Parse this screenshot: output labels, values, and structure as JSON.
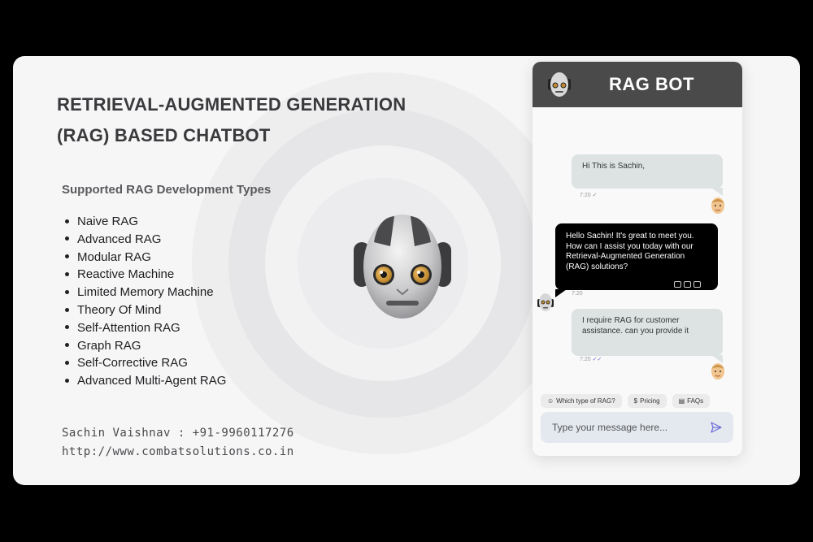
{
  "page": {
    "title_line1": "RETRIEVAL-AUGMENTED GENERATION",
    "title_line2": "(RAG) BASED CHATBOT",
    "subtitle": "Supported RAG Development Types",
    "types": [
      "Naive RAG",
      "Advanced RAG",
      "Modular RAG",
      "Reactive Machine",
      "Limited Memory Machine",
      "Theory Of Mind",
      "Self-Attention RAG",
      "Graph RAG",
      "Self-Corrective RAG",
      "Advanced Multi-Agent RAG"
    ],
    "contact_line": "Sachin Vaishnav : +91-9960117276",
    "website": "http://www.combatsolutions.co.in"
  },
  "chat": {
    "header_title": "RAG BOT",
    "messages": [
      {
        "from": "user",
        "text": "Hi This is Sachin,",
        "time": "7:20"
      },
      {
        "from": "bot",
        "text": "Hello Sachin! It's great to meet you. How can I assist you today with our Retrieval-Augmented Generation (RAG) solutions?",
        "time": "7:20"
      },
      {
        "from": "user",
        "text": "I require RAG for customer assistance. can you provide it",
        "time": "7:20"
      }
    ],
    "quick_replies": [
      {
        "icon": "smile-emoji-icon",
        "label": "Which type of RAG?"
      },
      {
        "icon": "money-bag-icon",
        "label": "Pricing"
      },
      {
        "icon": "notebook-icon",
        "label": "FAQs"
      }
    ],
    "input_placeholder": "Type your message here..."
  },
  "colors": {
    "header_bg": "#4a4a4a",
    "bot_bubble": "#000000",
    "user_bubble": "#dde3e3",
    "send_accent": "#6b6bd8"
  }
}
